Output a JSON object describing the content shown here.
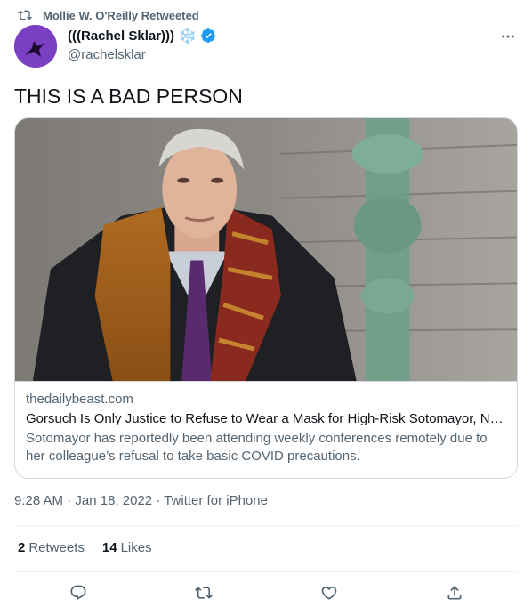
{
  "retweet": {
    "label": "Mollie W. O'Reilly Retweeted"
  },
  "author": {
    "name": "(((Rachel Sklar)))",
    "emoji": "❄️",
    "handle": "@rachelsklar"
  },
  "tweet": {
    "text": "THIS IS A BAD PERSON"
  },
  "card": {
    "domain": "thedailybeast.com",
    "title": "Gorsuch Is Only Justice to Refuse to Wear a Mask for High-Risk Sotomayor, NP...",
    "description": "Sotomayor has reportedly been attending weekly conferences remotely due to her colleague’s refusal to take basic COVID precautions."
  },
  "meta": {
    "time": "9:28 AM",
    "date": "Jan 18, 2022",
    "source": "Twitter for iPhone"
  },
  "stats": {
    "retweets_count": "2",
    "retweets_label": "Retweets",
    "likes_count": "14",
    "likes_label": "Likes"
  },
  "icons": {
    "retweet": "retweet-icon",
    "more": "more-dots-icon",
    "verified": "verified-badge-icon",
    "reply": "reply-icon",
    "like": "like-icon",
    "share": "share-icon"
  },
  "colors": {
    "verified": "#1d9bf0",
    "text": "#0f1419",
    "secondary": "#536471",
    "border": "#cfd9de"
  }
}
